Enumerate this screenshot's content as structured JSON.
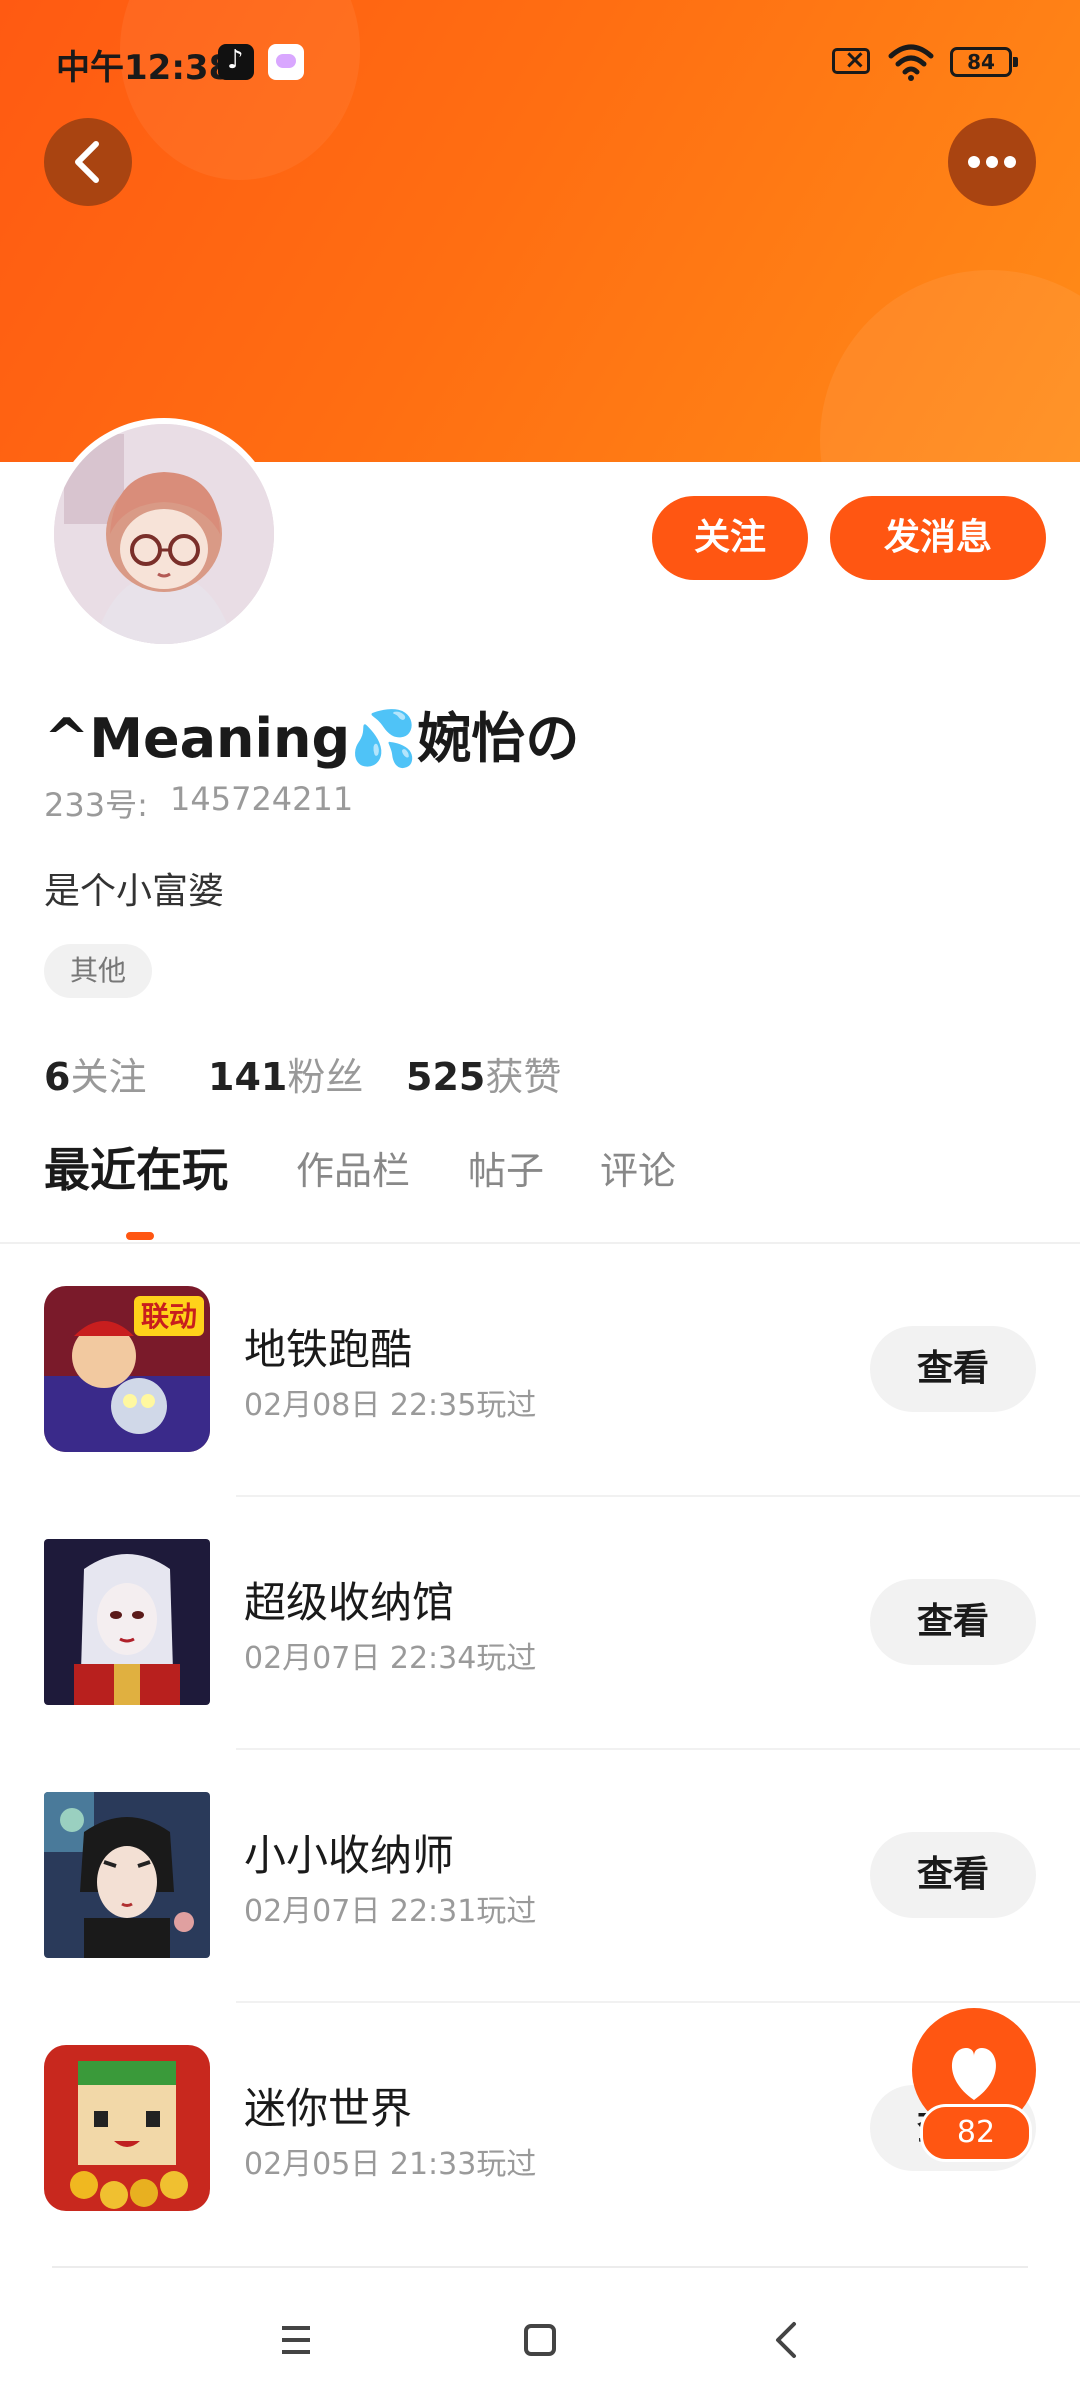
{
  "status_bar": {
    "time": "中午12:38",
    "battery": "84",
    "icons": [
      "tiktok-icon",
      "message-app-icon",
      "battery-saver-icon",
      "wifi-icon",
      "battery-icon"
    ]
  },
  "header": {
    "back_icon": "back-arrow-icon",
    "more_icon": "more-dots-icon",
    "gradient_colors": [
      "#ff5a12",
      "#ff8c18"
    ]
  },
  "profile": {
    "name": "^Meaning💦婉怡の",
    "id_label": "233号:",
    "id_value": "145724211",
    "bio": "是个小富婆",
    "tag": "其他",
    "follow_label": "关注",
    "message_label": "发消息",
    "stats": [
      {
        "num": "6",
        "label": "关注"
      },
      {
        "num": "141",
        "label": "粉丝"
      },
      {
        "num": "525",
        "label": "获赞"
      }
    ]
  },
  "tabs": [
    {
      "label": "最近在玩",
      "active": true
    },
    {
      "label": "作品栏",
      "active": false
    },
    {
      "label": "帖子",
      "active": false
    },
    {
      "label": "评论",
      "active": false
    }
  ],
  "games": [
    {
      "name": "地铁跑酷",
      "time": "02月08日 22:35玩过",
      "button": "查看",
      "icon_badge": "联动"
    },
    {
      "name": "超级收纳馆",
      "time": "02月07日 22:34玩过",
      "button": "查看"
    },
    {
      "name": "小小收纳师",
      "time": "02月07日 22:31玩过",
      "button": "查看"
    },
    {
      "name": "迷你世界",
      "time": "02月05日 21:33玩过",
      "button": "查看"
    }
  ],
  "like_fab": {
    "count": "82",
    "icon": "heart-icon"
  },
  "accent_color": "#ff5612",
  "nav": {
    "icons": [
      "menu-icon",
      "home-square-icon",
      "back-triangle-icon"
    ]
  }
}
